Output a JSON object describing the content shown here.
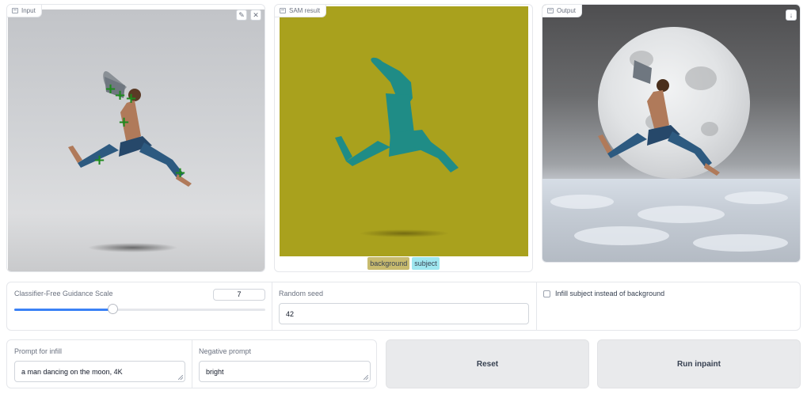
{
  "panels": {
    "input": {
      "label": "Input",
      "edit_icon": "pencil-icon",
      "clear_icon": "close-icon"
    },
    "sam": {
      "label": "SAM result",
      "legend": [
        {
          "label": "background",
          "color": "#c8bb6e"
        },
        {
          "label": "subject",
          "color": "#9fe7f0"
        }
      ]
    },
    "output": {
      "label": "Output",
      "download_icon": "download-icon"
    }
  },
  "controls": {
    "guidance": {
      "label": "Classifier-Free Guidance Scale",
      "value": "7",
      "level": 0.39
    },
    "seed": {
      "label": "Random seed",
      "value": "42"
    },
    "infill_subject": {
      "label": "Infill subject instead of background",
      "checked": false
    },
    "prompt": {
      "label": "Prompt for infill",
      "value": "a man dancing on the moon, 4K"
    },
    "negative": {
      "label": "Negative prompt",
      "value": "bright"
    }
  },
  "buttons": {
    "reset": "Reset",
    "run": "Run inpaint"
  },
  "colors": {
    "accent": "#3b82f6",
    "sam_background": "#a9a11d",
    "sam_subject": "#1f8c86",
    "point_marker": "#1e8a1e"
  }
}
